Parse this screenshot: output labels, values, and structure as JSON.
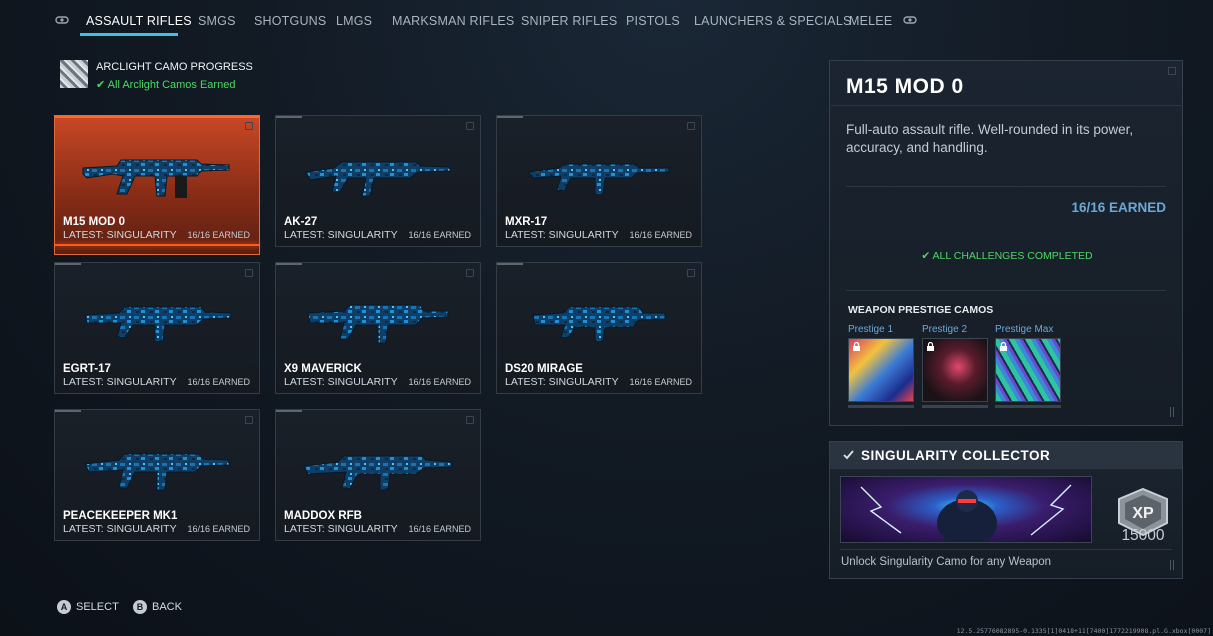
{
  "nav": {
    "left_bumper_icon": "lb-bumper-icon",
    "right_bumper_icon": "rb-bumper-icon",
    "tabs": [
      {
        "label": "Assault Rifles",
        "active": true
      },
      {
        "label": "SMGs",
        "active": false
      },
      {
        "label": "Shotguns",
        "active": false
      },
      {
        "label": "LMGs",
        "active": false
      },
      {
        "label": "Marksman Rifles",
        "active": false
      },
      {
        "label": "Sniper Rifles",
        "active": false
      },
      {
        "label": "Pistols",
        "active": false
      },
      {
        "label": "Launchers & Specials",
        "active": false
      },
      {
        "label": "Melee",
        "active": false
      }
    ]
  },
  "camo_progress": {
    "title": "Arclight Camo Progress",
    "status": "✔ All Arclight Camos Earned"
  },
  "weapons": [
    {
      "name": "M15 MOD 0",
      "latest": "LATEST: SINGULARITY",
      "earned": "16/16 EARNED",
      "selected": true
    },
    {
      "name": "AK-27",
      "latest": "LATEST: SINGULARITY",
      "earned": "16/16 EARNED",
      "selected": false
    },
    {
      "name": "MXR-17",
      "latest": "LATEST: SINGULARITY",
      "earned": "16/16 EARNED",
      "selected": false
    },
    {
      "name": "EGRT-17",
      "latest": "LATEST: SINGULARITY",
      "earned": "16/16 EARNED",
      "selected": false
    },
    {
      "name": "X9 MAVERICK",
      "latest": "LATEST: SINGULARITY",
      "earned": "16/16 EARNED",
      "selected": false
    },
    {
      "name": "DS20 MIRAGE",
      "latest": "LATEST: SINGULARITY",
      "earned": "16/16 EARNED",
      "selected": false
    },
    {
      "name": "PEACEKEEPER MK1",
      "latest": "LATEST: SINGULARITY",
      "earned": "16/16 EARNED",
      "selected": false
    },
    {
      "name": "MADDOX RFB",
      "latest": "LATEST: SINGULARITY",
      "earned": "16/16 EARNED",
      "selected": false
    }
  ],
  "detail": {
    "title": "M15 MOD 0",
    "description": "Full-auto assault rifle. Well-rounded in its power, accuracy, and handling.",
    "earned": "16/16 EARNED",
    "challenges": "✔ ALL CHALLENGES COMPLETED",
    "prestige_title": "WEAPON PRESTIGE CAMOS",
    "prestige": [
      {
        "label": "Prestige 1",
        "locked": true
      },
      {
        "label": "Prestige 2",
        "locked": true
      },
      {
        "label": "Prestige Max",
        "locked": true
      }
    ]
  },
  "reward": {
    "title": "Singularity Collector",
    "xp_badge": "XP",
    "xp_value": "15000",
    "description": "Unlock Singularity Camo for any Weapon"
  },
  "hints": {
    "select_key": "A",
    "select_label": "Select",
    "back_key": "B",
    "back_label": "Back"
  },
  "build_info": "12.5.25776082895-0.1335[1]0418+11[7400]1772219908.pl.G.xbox[0007]",
  "colors": {
    "accent": "#3dc2e6",
    "selected_card": "#c94826",
    "success": "#4dd864",
    "info_blue": "#6aa9d7"
  }
}
